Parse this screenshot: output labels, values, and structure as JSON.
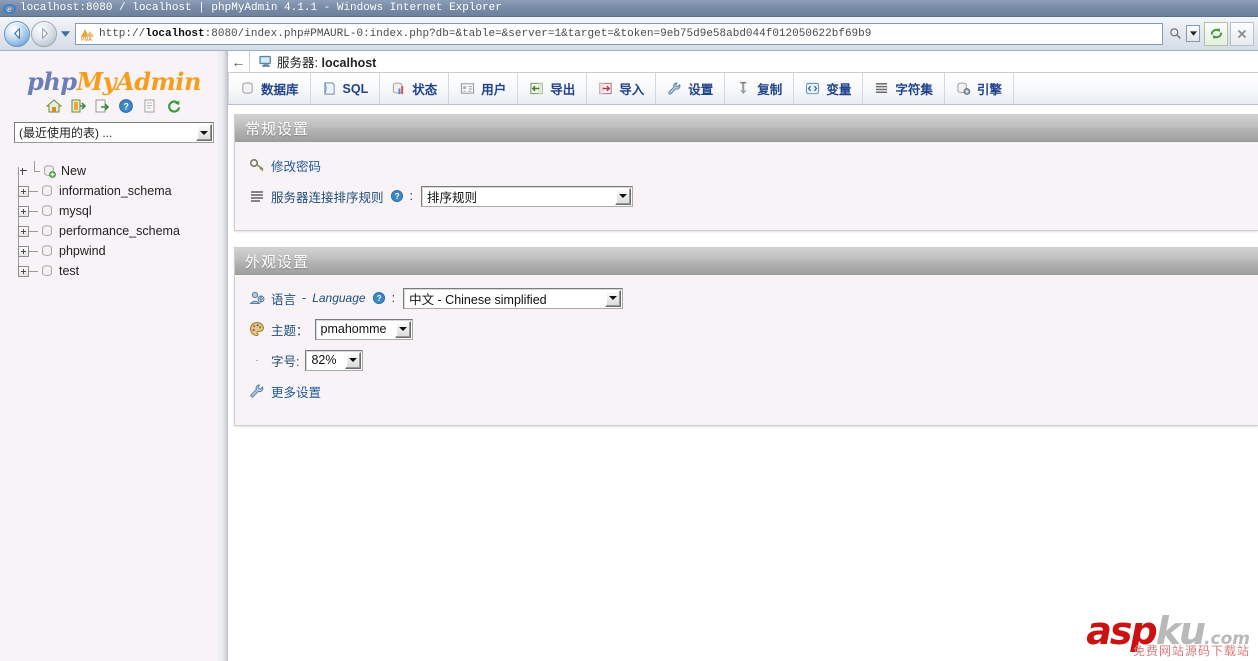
{
  "browser": {
    "window_title": "localhost:8080 / localhost | phpMyAdmin 4.1.1 - Windows Internet Explorer",
    "url_prefix": "http://",
    "url_host": "localhost",
    "url_rest": ":8080/index.php#PMAURL-0:index.php?db=&table=&server=1&target=&token=9eb75d9e58abd044f012050622bf69b9",
    "back_icon": "back-arrow-icon",
    "forward_icon": "forward-arrow-icon",
    "history_icon": "history-dropdown-icon",
    "favicon": "pma-favicon",
    "search_icon": "search-icon",
    "search_dropdown_icon": "chevron-down-icon",
    "refresh_icon": "refresh-icon",
    "stop_icon": "stop-icon"
  },
  "sidebar": {
    "logo": {
      "php": "php",
      "my": "My",
      "admin": "Admin"
    },
    "logo_icons": [
      {
        "name": "home-icon"
      },
      {
        "name": "logout-icon"
      },
      {
        "name": "docs-external-icon"
      },
      {
        "name": "help-icon"
      },
      {
        "name": "console-icon"
      },
      {
        "name": "reload-icon"
      }
    ],
    "recent_tables": {
      "value": "(最近使用的表) ...",
      "dropdown_icon": "chevron-down-icon"
    },
    "tree": [
      {
        "label": "New",
        "type": "new",
        "icon": "new-database-icon"
      },
      {
        "label": "information_schema",
        "type": "db",
        "icon": "database-icon"
      },
      {
        "label": "mysql",
        "type": "db",
        "icon": "database-icon"
      },
      {
        "label": "performance_schema",
        "type": "db",
        "icon": "database-icon"
      },
      {
        "label": "phpwind",
        "type": "db",
        "icon": "database-icon"
      },
      {
        "label": "test",
        "type": "db",
        "icon": "database-icon"
      }
    ]
  },
  "main": {
    "back_label": "←",
    "breadcrumb": {
      "icon": "server-monitor-icon",
      "label": "服务器:",
      "value": "localhost"
    },
    "tabs": [
      {
        "label": "数据库",
        "icon": "database-icon"
      },
      {
        "label": "SQL",
        "icon": "sql-icon"
      },
      {
        "label": "状态",
        "icon": "status-chart-icon"
      },
      {
        "label": "用户",
        "icon": "users-icon"
      },
      {
        "label": "导出",
        "icon": "export-icon"
      },
      {
        "label": "导入",
        "icon": "import-icon"
      },
      {
        "label": "设置",
        "icon": "wrench-icon"
      },
      {
        "label": "复制",
        "icon": "replication-icon"
      },
      {
        "label": "变量",
        "icon": "variables-icon"
      },
      {
        "label": "字符集",
        "icon": "charset-icon"
      },
      {
        "label": "引擎",
        "icon": "engine-icon"
      }
    ],
    "panels": [
      {
        "title": "常规设置",
        "rows": {
          "change_password": {
            "label": "修改密码",
            "icon": "key-password-icon"
          },
          "collation": {
            "label": "服务器连接排序规则",
            "icon": "collation-lines-icon",
            "help_icon": "help-icon",
            "colon": ":",
            "value": "排序规则",
            "dropdown_icon": "chevron-down-icon"
          }
        }
      },
      {
        "title": "外观设置",
        "rows": {
          "language": {
            "label_cn": "语言",
            "label_sep": "-",
            "label_en": "Language",
            "icon": "language-globe-icon",
            "help_icon": "help-icon",
            "colon": ":",
            "value": "中文 - Chinese simplified",
            "dropdown_icon": "chevron-down-icon"
          },
          "theme": {
            "label": "主题：",
            "icon": "theme-palette-icon",
            "value": "pmahomme",
            "dropdown_icon": "chevron-down-icon"
          },
          "font_size": {
            "bullet": "·",
            "label": "字号:",
            "value": "82%",
            "dropdown_icon": "chevron-down-icon"
          },
          "more_settings": {
            "label": "更多设置",
            "icon": "wrench-icon"
          }
        }
      }
    ]
  },
  "watermark": {
    "asp": "asp",
    "ku": "ku",
    "com": ".com",
    "subtitle": "免费网站源码下载站"
  }
}
